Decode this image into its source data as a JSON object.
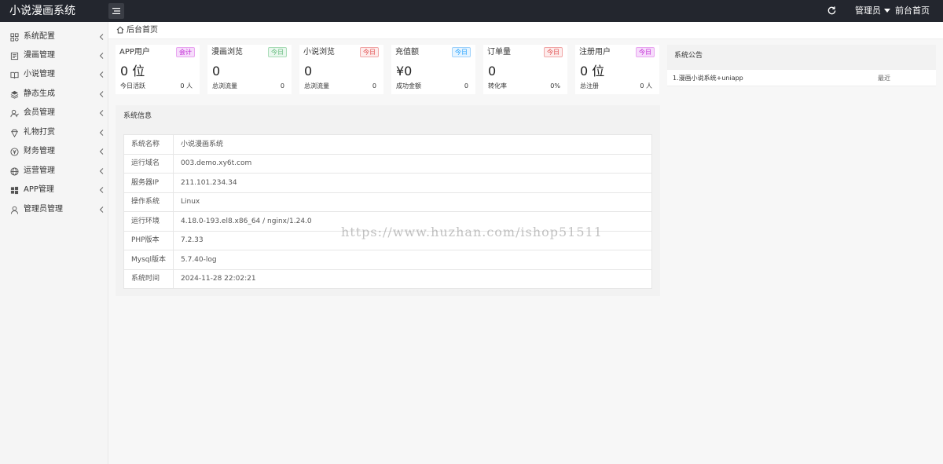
{
  "app": {
    "title": "小说漫画系统"
  },
  "topbar": {
    "admin_label": "管理员",
    "frontpage_label": "前台首页"
  },
  "sidebar": {
    "items": [
      {
        "label": "系统配置",
        "icon": "settings-icon"
      },
      {
        "label": "漫画管理",
        "icon": "comic-icon"
      },
      {
        "label": "小说管理",
        "icon": "book-icon"
      },
      {
        "label": "静态生成",
        "icon": "layers-icon"
      },
      {
        "label": "会员管理",
        "icon": "member-icon"
      },
      {
        "label": "礼物打赏",
        "icon": "gift-icon"
      },
      {
        "label": "财务管理",
        "icon": "yen-icon"
      },
      {
        "label": "运营管理",
        "icon": "globe-icon"
      },
      {
        "label": "APP管理",
        "icon": "windows-icon"
      },
      {
        "label": "管理员管理",
        "icon": "user-icon"
      }
    ]
  },
  "breadcrumb": {
    "label": "后台首页"
  },
  "stats": [
    {
      "title": "APP用户",
      "badge": "会计",
      "badge_color": "#c026d3",
      "badge_bg": "#f6dcfb",
      "value": "0 位",
      "foot_label": "今日活跃",
      "foot_value": "0 人"
    },
    {
      "title": "漫画浏览",
      "badge": "今日",
      "badge_color": "#5fb878",
      "badge_bg": "#e9f7ee",
      "value": "0",
      "foot_label": "总浏流量",
      "foot_value": "0"
    },
    {
      "title": "小说浏览",
      "badge": "今日",
      "badge_color": "#e04b4b",
      "badge_bg": "#fdecec",
      "value": "0",
      "foot_label": "总浏流量",
      "foot_value": "0"
    },
    {
      "title": "充值额",
      "badge": "今日",
      "badge_color": "#1e9fff",
      "badge_bg": "#e6f4ff",
      "value": "¥0",
      "foot_label": "成功金额",
      "foot_value": "0"
    },
    {
      "title": "订单量",
      "badge": "今日",
      "badge_color": "#e04b4b",
      "badge_bg": "#fdecec",
      "value": "0",
      "foot_label": "转化率",
      "foot_value": "0%"
    },
    {
      "title": "注册用户",
      "badge": "今日",
      "badge_color": "#c026d3",
      "badge_bg": "#f6dcfb",
      "value": "0 位",
      "foot_label": "总注册",
      "foot_value": "0 人"
    }
  ],
  "system_info": {
    "title": "系统信息",
    "rows": [
      {
        "key": "系统名称",
        "value": "小说漫画系统"
      },
      {
        "key": "运行域名",
        "value": "003.demo.xy6t.com"
      },
      {
        "key": "服务器IP",
        "value": "211.101.234.34"
      },
      {
        "key": "操作系统",
        "value": "Linux"
      },
      {
        "key": "运行环境",
        "value": "4.18.0-193.el8.x86_64 / nginx/1.24.0"
      },
      {
        "key": "PHP版本",
        "value": "7.2.33"
      },
      {
        "key": "Mysql版本",
        "value": "5.7.40-log"
      },
      {
        "key": "系统时间",
        "value": "2024-11-28 22:02:21"
      }
    ]
  },
  "notice": {
    "title": "系统公告",
    "items": [
      {
        "text": "1.漫画小说系统+uniapp",
        "date": "最近"
      }
    ]
  },
  "watermark": "https://www.huzhan.com/ishop51511"
}
